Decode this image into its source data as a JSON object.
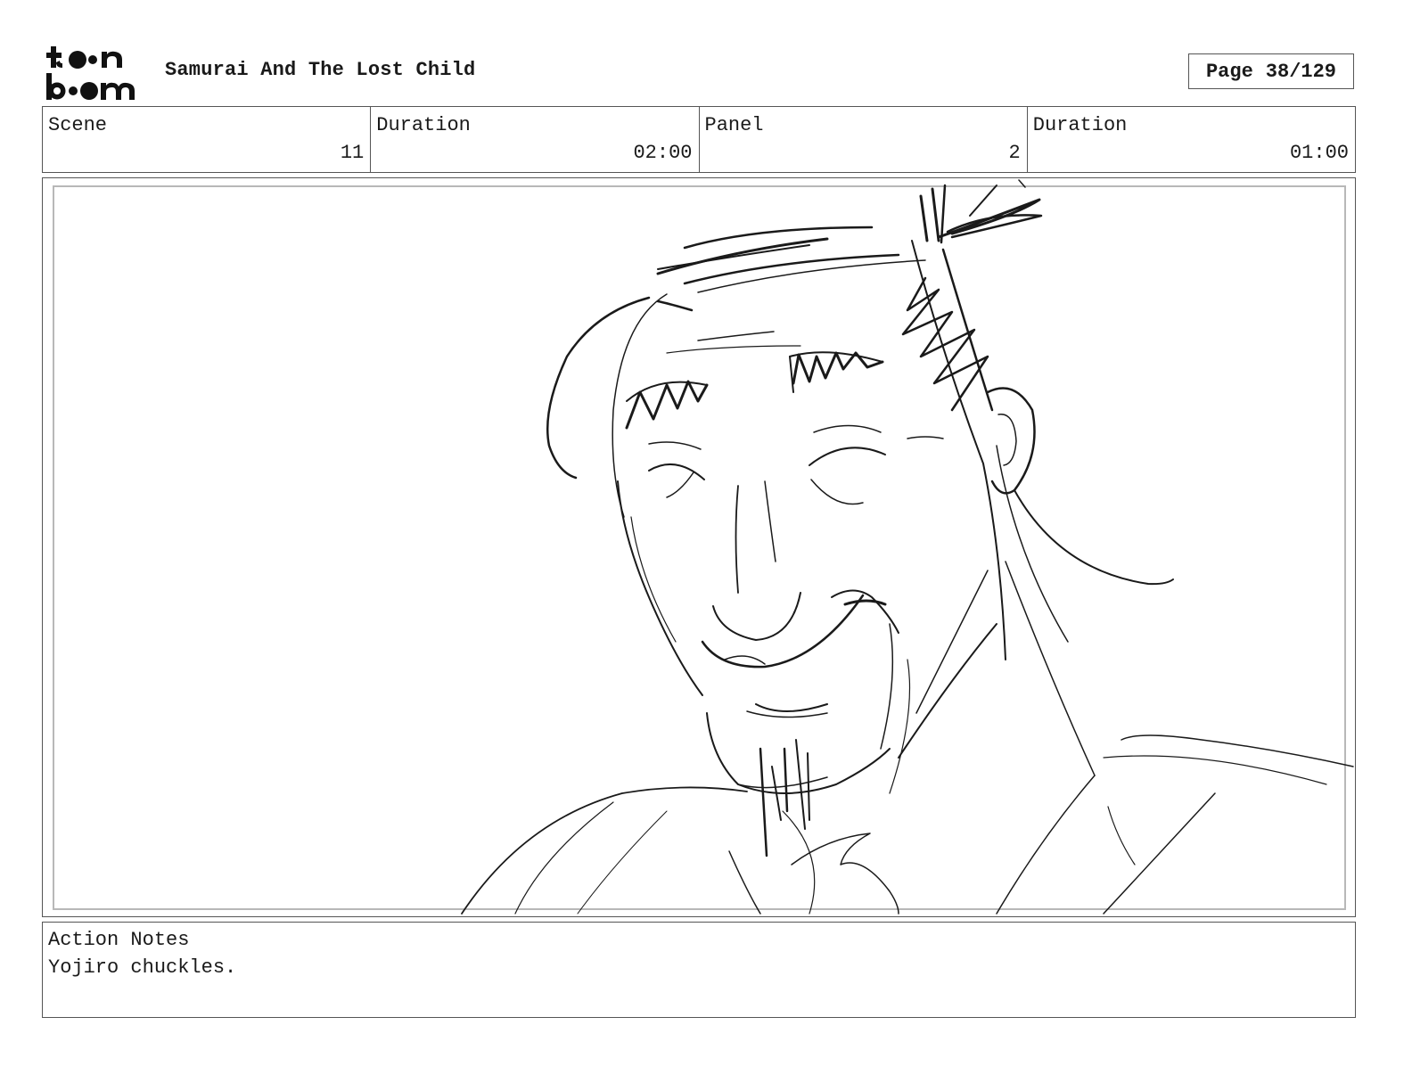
{
  "header": {
    "logo_text": "toonboom",
    "project_title": "Samurai And The Lost Child",
    "page_label": "Page",
    "page_number": "38/129"
  },
  "info": {
    "scene_label": "Scene",
    "scene_value": "11",
    "scene_duration_label": "Duration",
    "scene_duration_value": "02:00",
    "panel_label": "Panel",
    "panel_value": "2",
    "panel_duration_label": "Duration",
    "panel_duration_value": "01:00"
  },
  "notes": {
    "label": "Action Notes",
    "text": "Yojiro chuckles."
  },
  "colors": {
    "ink": "#1a1a1a",
    "border": "#555555",
    "inner_border": "#b8b8b8"
  }
}
